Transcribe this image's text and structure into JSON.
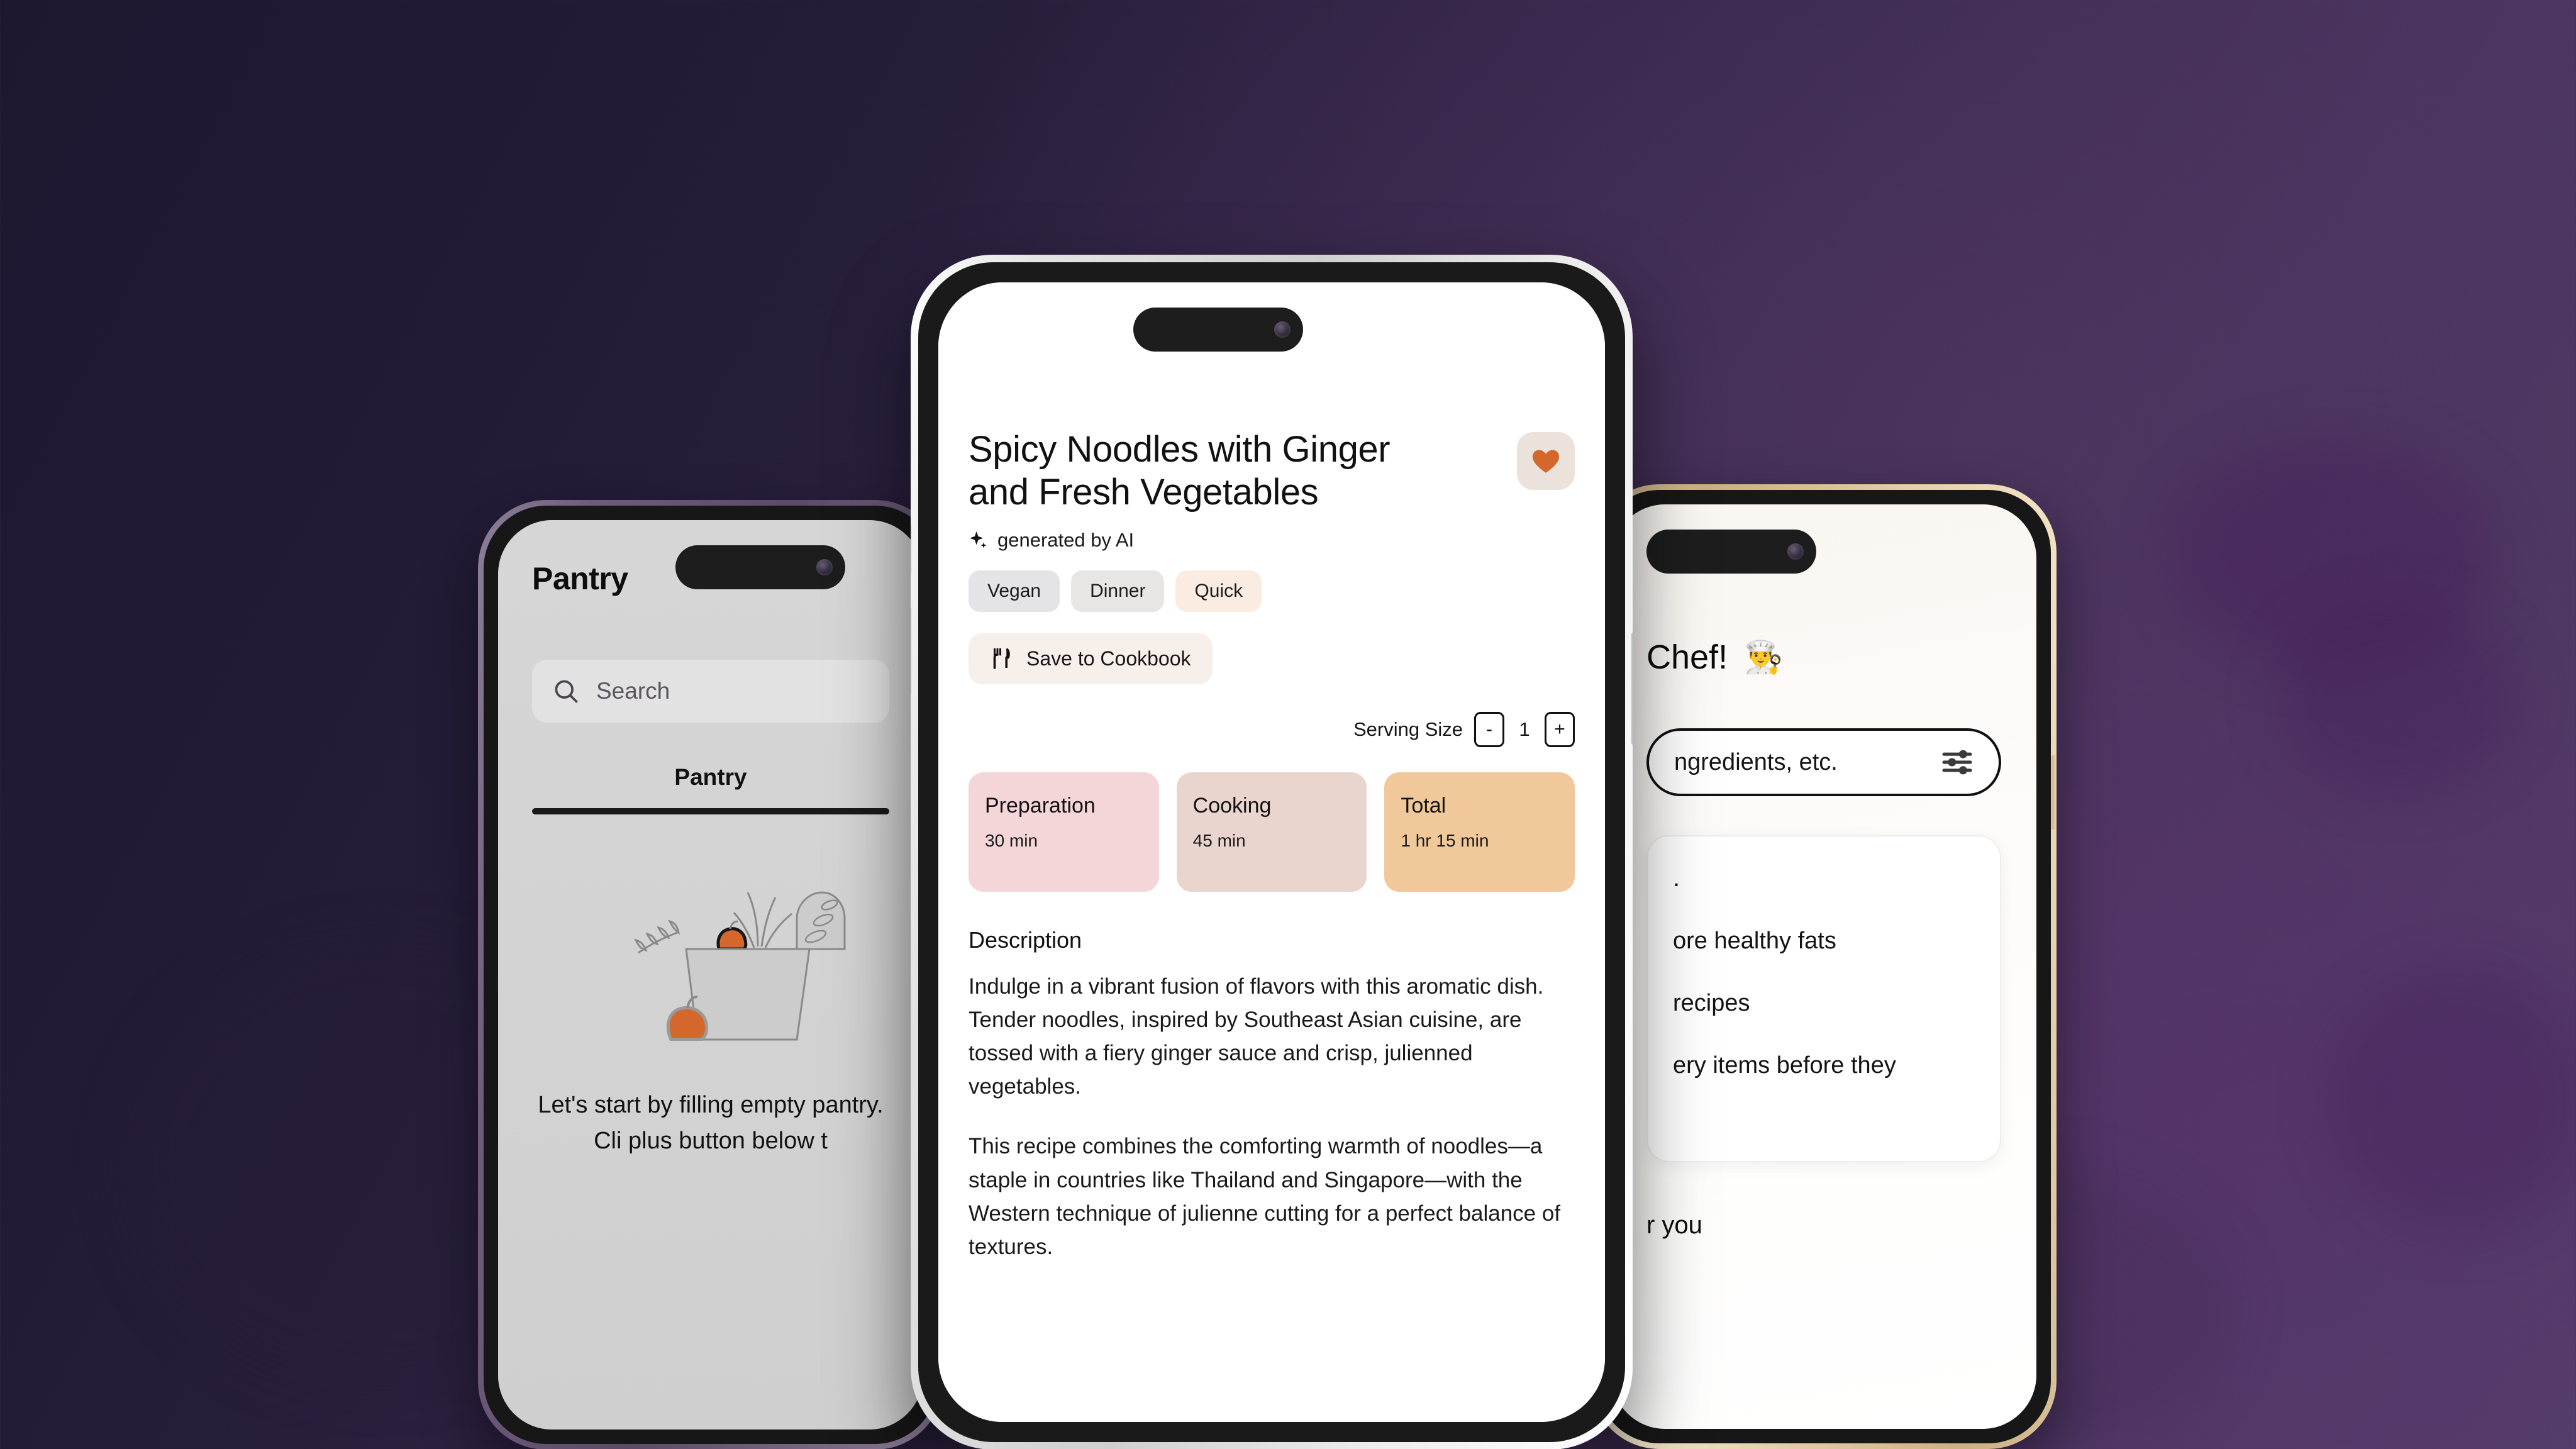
{
  "background": {
    "colors": [
      "#1d1730",
      "#35264a",
      "#52406a"
    ]
  },
  "left_phone": {
    "frame_color": "#6d5c7b",
    "app_title": "Pantry",
    "search": {
      "placeholder": "Search",
      "icon": "search-icon"
    },
    "tab": {
      "label": "Pantry",
      "selected": true
    },
    "illustration": "grocery-bag-illustration",
    "empty_state": "Let's start by filling\nempty pantry. Cli\nplus button below t"
  },
  "center_phone": {
    "frame_color": "#cfcfcf",
    "recipe": {
      "title": "Spicy Noodles with Ginger and Fresh Vegetables",
      "ai_badge": "generated by AI",
      "ai_badge_icon": "sparkle-icon",
      "favorite_icon": "heart-icon",
      "favorite_color": "#d4682c",
      "tags": [
        "Vegan",
        "Dinner",
        "Quick"
      ],
      "save_button": {
        "label": "Save to Cookbook",
        "icon": "fork-knife-icon"
      },
      "serving": {
        "label": "Serving Size",
        "decrement": "-",
        "value": "1",
        "increment": "+"
      },
      "times": [
        {
          "label": "Preparation",
          "value": "30 min",
          "color": "#f4d6d9"
        },
        {
          "label": "Cooking",
          "value": "45 min",
          "color": "#e9d5cd"
        },
        {
          "label": "Total",
          "value": "1 hr 15 min",
          "color": "#f0c89a"
        }
      ],
      "description_heading": "Description",
      "description_paragraphs": [
        "Indulge in a vibrant fusion of flavors with this aromatic dish. Tender noodles, inspired by Southeast Asian cuisine, are tossed with a fiery ginger sauce and crisp, julienned vegetables.",
        "This recipe combines the comforting warmth of noodles—a staple in countries like Thailand and Singapore—with the Western technique of julienne cutting for a perfect balance of textures."
      ]
    }
  },
  "right_phone": {
    "frame_color": "#cbb083",
    "greeting": "Chef!",
    "greeting_emoji": "👨‍🍳",
    "search": {
      "placeholder": "ngredients, etc.",
      "filter_icon": "sliders-icon"
    },
    "tips_card": {
      "title": ".",
      "items": [
        "ore healthy fats",
        "recipes",
        "ery items before they"
      ]
    },
    "footer": "r you"
  }
}
